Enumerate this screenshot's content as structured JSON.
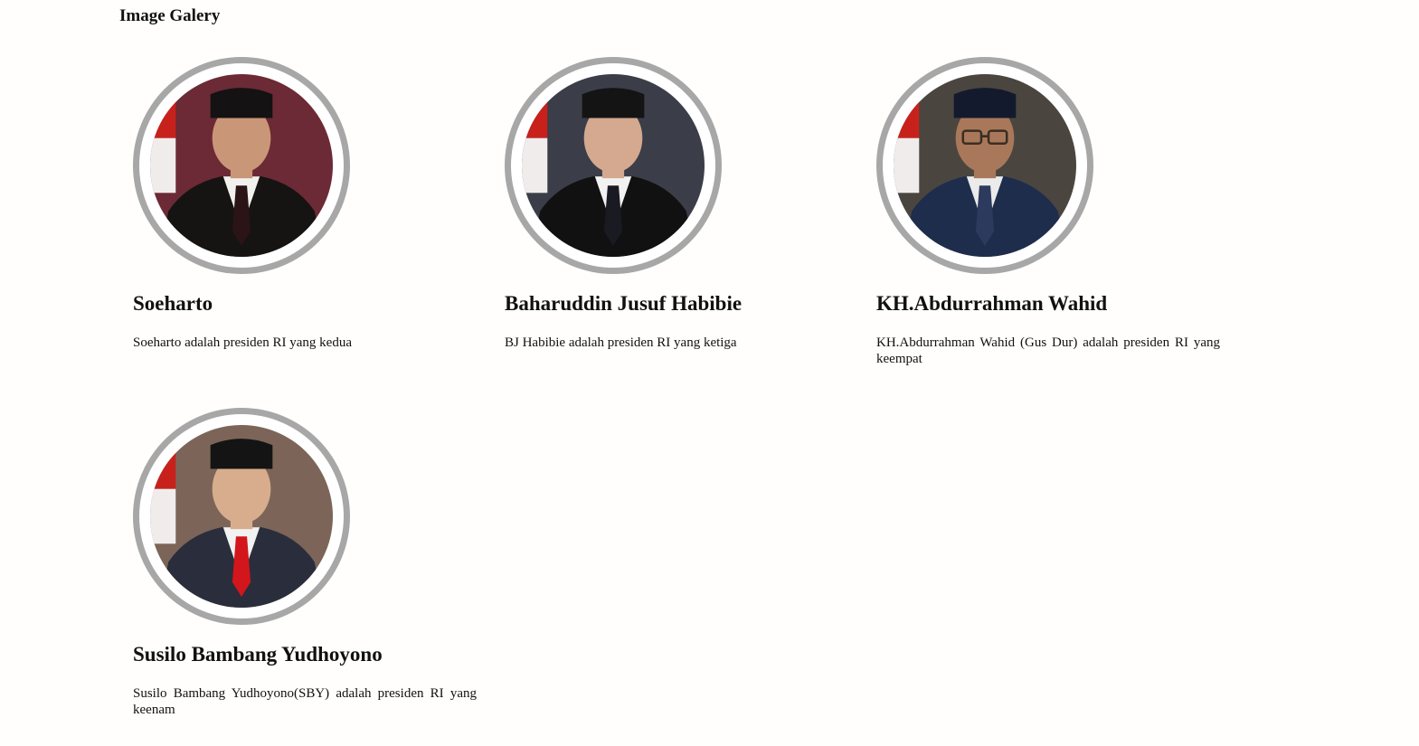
{
  "page": {
    "title": "Image Galery"
  },
  "gallery": [
    {
      "name": "Soeharto",
      "description": "Soeharto adalah presiden RI yang kedua",
      "portrait_icon": "portrait-soeharto",
      "colors": {
        "bg": "#6b2a35",
        "suit": "#161313",
        "tie": "#2a1416",
        "skin": "#c99677",
        "cap": "#141212",
        "shirt": "#f1f0ed"
      }
    },
    {
      "name": "Baharuddin Jusuf Habibie",
      "description": "BJ Habibie adalah presiden RI yang ketiga",
      "portrait_icon": "portrait-habibie",
      "colors": {
        "bg": "#3b3d48",
        "suit": "#111111",
        "tie": "#1a1a22",
        "skin": "#d4a98f",
        "cap": "#141414",
        "shirt": "#f2f2f2"
      }
    },
    {
      "name": "KH.Abdurrahman Wahid",
      "description": "KH.Abdurrahman Wahid (Gus Dur) adalah presiden RI yang keempat",
      "portrait_icon": "portrait-gusdur",
      "colors": {
        "bg": "#4a463f",
        "suit": "#1f2d4c",
        "tie": "#2c3a5e",
        "skin": "#a9785b",
        "cap": "#141a2e",
        "shirt": "#ebebeb"
      }
    },
    {
      "name": "Susilo Bambang Yudhoyono",
      "description": "Susilo Bambang Yudhoyono(SBY) adalah presiden RI yang keenam",
      "portrait_icon": "portrait-sby",
      "colors": {
        "bg": "#7c6558",
        "suit": "#2a2e3c",
        "tie": "#d3161b",
        "skin": "#d8ad8d",
        "cap": "#141414",
        "shirt": "#f2f2f2"
      }
    }
  ]
}
